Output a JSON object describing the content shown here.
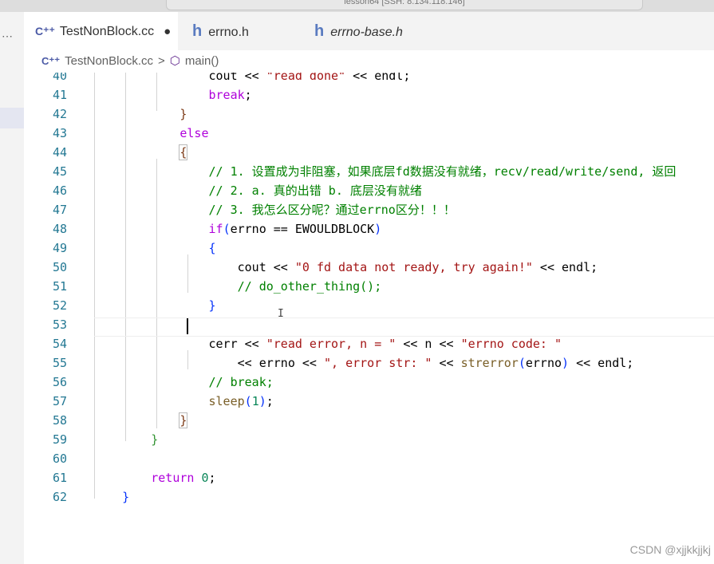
{
  "titlebar": {
    "command_center": "lesson64 [SSH: 8.134.118.146]"
  },
  "tabs": [
    {
      "label": "TestNonBlock.cc",
      "icon": "cpp-icon",
      "dirty": "●",
      "active": true
    },
    {
      "label": "errno.h",
      "icon": "h-icon",
      "active": false
    },
    {
      "label": "errno-base.h",
      "icon": "h-icon",
      "active": false
    }
  ],
  "breadcrumb": {
    "file": "TestNonBlock.cc",
    "separator": ">",
    "symbol": "main()"
  },
  "lines": [
    {
      "n": "40",
      "t": "                cout << \"read done\" << endl;"
    },
    {
      "n": "41",
      "t": "                break;"
    },
    {
      "n": "42",
      "t": "            }"
    },
    {
      "n": "43",
      "t": "            else"
    },
    {
      "n": "44",
      "t": "            {"
    },
    {
      "n": "45",
      "t": "                // 1. 设置成为非阻塞，如果底层fd数据没有就绪，recv/read/write/send, 返回"
    },
    {
      "n": "46",
      "t": "                // 2. a. 真的出错 b. 底层没有就绪"
    },
    {
      "n": "47",
      "t": "                // 3. 我怎么区分呢？通过errno区分！！！"
    },
    {
      "n": "48",
      "t": "                if(errno == EWOULDBLOCK)"
    },
    {
      "n": "49",
      "t": "                {"
    },
    {
      "n": "50",
      "t": "                    cout << \"0 fd data not ready, try again!\" << endl;"
    },
    {
      "n": "51",
      "t": "                    // do_other_thing();"
    },
    {
      "n": "52",
      "t": "                }"
    },
    {
      "n": "53",
      "t": ""
    },
    {
      "n": "54",
      "t": "                cerr << \"read error, n = \" << n << \"errno code: \""
    },
    {
      "n": "55",
      "t": "                    << errno << \", error str: \" << strerror(errno) << endl;"
    },
    {
      "n": "56",
      "t": "                // break;"
    },
    {
      "n": "57",
      "t": "                sleep(1);"
    },
    {
      "n": "58",
      "t": "            }"
    },
    {
      "n": "59",
      "t": "        }"
    },
    {
      "n": "60",
      "t": ""
    },
    {
      "n": "61",
      "t": "        return 0;"
    },
    {
      "n": "62",
      "t": "    }"
    }
  ],
  "watermark": "CSDN @xjjkkjjkj",
  "colors": {
    "keyword": "#0000ff",
    "control": "#af00db",
    "string": "#a31515",
    "number": "#098658",
    "comment": "#008000",
    "function": "#795e26",
    "line_number": "#237893"
  }
}
